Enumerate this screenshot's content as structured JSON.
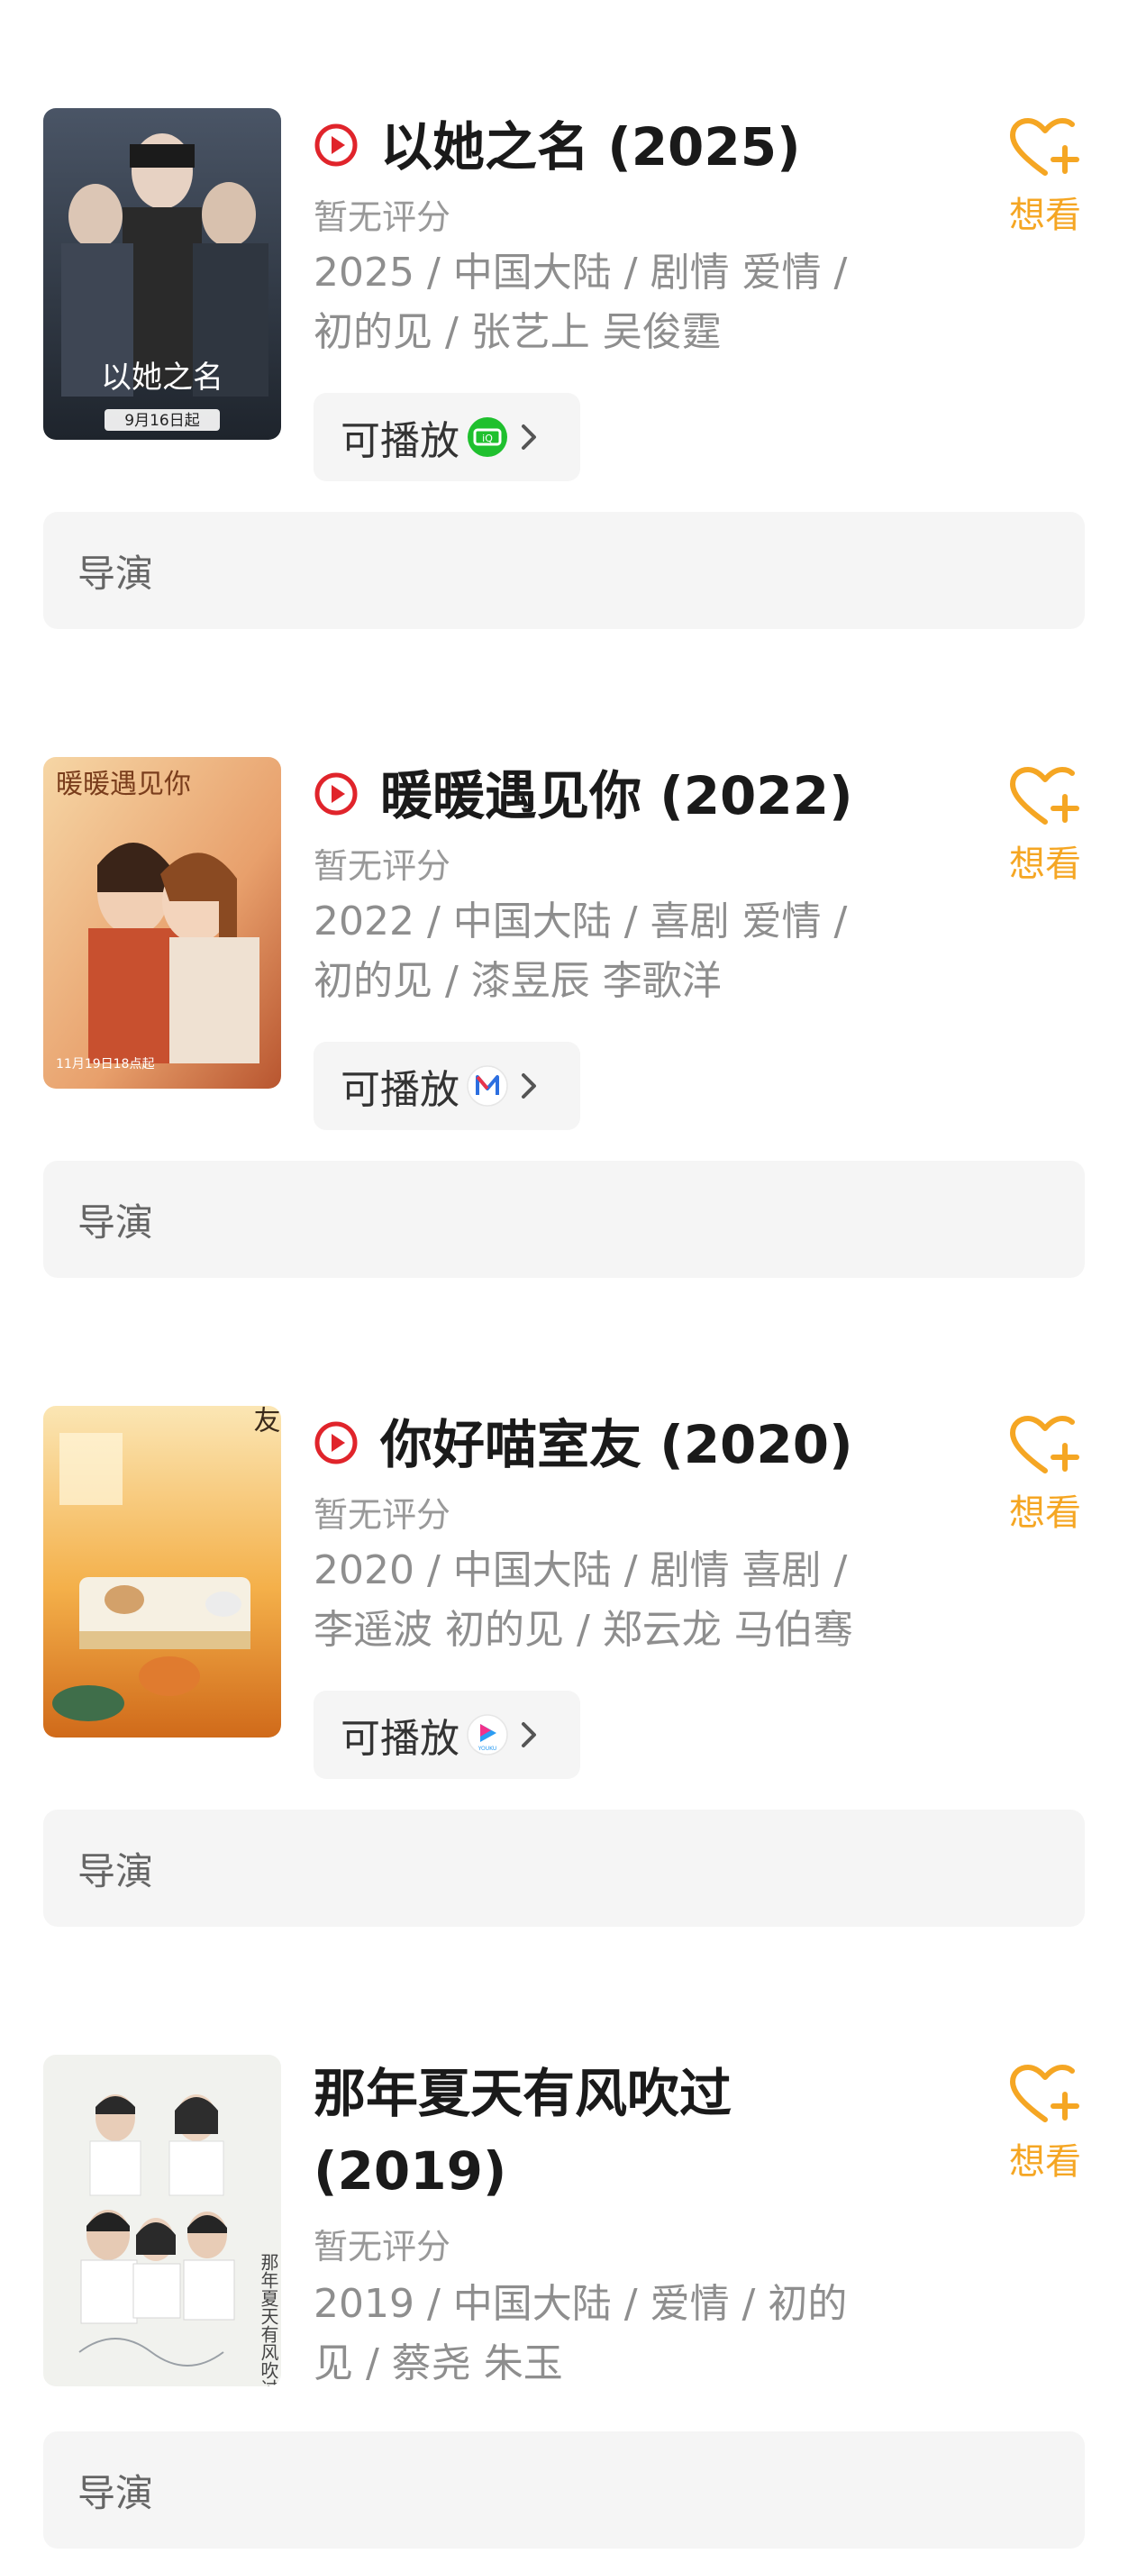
{
  "accent_color": "#f5a623",
  "play_icon_color": "#e0242b",
  "want_label": "想看",
  "director_label": "导演",
  "playable_label": "可播放",
  "items": [
    {
      "title": "以她之名 (2025)",
      "rating": "暂无评分",
      "meta_line1": "2025 / 中国大陆 / 剧情 爱情 /",
      "meta_line2": "初的见 / 张艺上 吴俊霆",
      "platform_icon": "iqiyi-logo",
      "poster_text": "以她之名",
      "poster_sub": "9月16日起"
    },
    {
      "title": "暖暖遇见你 (2022)",
      "rating": "暂无评分",
      "meta_line1": "2022 / 中国大陆 / 喜剧 爱情 /",
      "meta_line2": "初的见 / 漆昱辰 李歌洋",
      "platform_icon": "mgtv-logo",
      "poster_text": "暖暖遇见你",
      "poster_sub": "11月19日18点起"
    },
    {
      "title": "你好喵室友 (2020)",
      "rating": "暂无评分",
      "meta_line1": "2020 / 中国大陆 / 剧情 喜剧 /",
      "meta_line2": "李遥波 初的见 / 郑云龙 马伯骞",
      "platform_icon": "youku-logo",
      "poster_text": "你好喵室友"
    },
    {
      "title_line1": "那年夏天有风吹过",
      "title_line2": "(2019)",
      "rating": "暂无评分",
      "meta_line1": "2019 / 中国大陆 / 爱情 / 初的",
      "meta_line2": "见 / 蔡尧 朱玉",
      "poster_text": "那年夏天有风吹过"
    }
  ]
}
